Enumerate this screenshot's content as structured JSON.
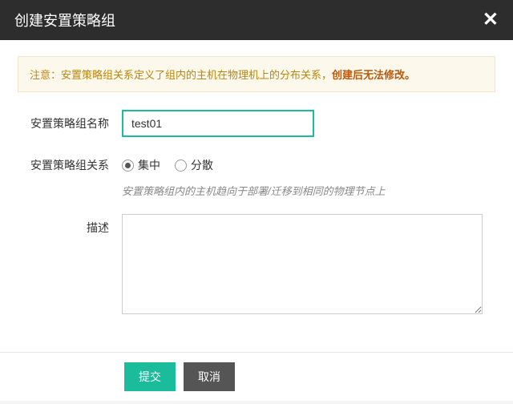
{
  "header": {
    "title": "创建安置策略组"
  },
  "notice": {
    "prefix": "注意：",
    "text": "安置策略组关系定义了组内的主机在物理机上的分布关系，",
    "highlight": "创建后无法修改。"
  },
  "form": {
    "name": {
      "label": "安置策略组名称",
      "value": "test01"
    },
    "relation": {
      "label": "安置策略组关系",
      "options": [
        {
          "label": "集中",
          "selected": true
        },
        {
          "label": "分散",
          "selected": false
        }
      ],
      "help": "安置策略组内的主机趋向于部署/迁移到相同的物理节点上"
    },
    "description": {
      "label": "描述",
      "value": ""
    }
  },
  "footer": {
    "submit": "提交",
    "cancel": "取消"
  }
}
